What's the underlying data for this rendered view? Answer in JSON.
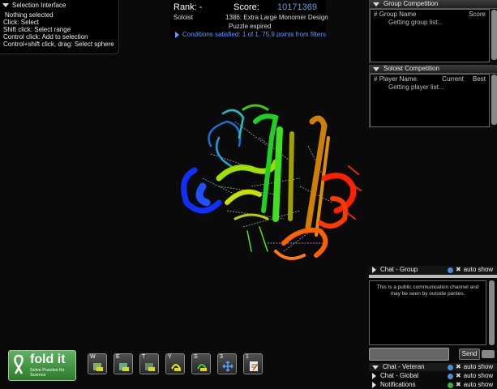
{
  "selection": {
    "title": "Selection Interface",
    "lines": [
      "Nothing selected",
      "Click: Select",
      "Shift click: Select range",
      "Control click: Add to selection",
      "Control+shift click, drag: Select sphere"
    ]
  },
  "score": {
    "rank_label": "Rank: -",
    "score_label": "Score:",
    "score_value": "10171369",
    "mode": "Soloist",
    "puzzle": "1386: Extra Large Monomer Design",
    "status": "Puzzle expired",
    "conditions": "Conditions satisfied: 1 of 1, 75.9 points from filters"
  },
  "group": {
    "title": "Group Competition",
    "col_num": "#",
    "col_name": "Group Name",
    "col_score": "Score",
    "loading": "Getting group list..."
  },
  "soloist": {
    "title": "Soloist Competition",
    "col_num": "#",
    "col_name": "Player Name",
    "col_current": "Current",
    "col_best": "Best",
    "loading": "Getting player list..."
  },
  "chat": {
    "group_title": "Chat - Group",
    "auto_show": "auto show",
    "message": "This is a public communication channel and may be seen by outside parties.",
    "send": "Send",
    "veteran": "Chat - Veteran",
    "global": "Chat - Global",
    "notifications": "Notifications"
  },
  "logo": {
    "name": "fold it",
    "tagline": "Solve Puzzles for Science"
  },
  "toolbar": [
    {
      "key": "W",
      "icon": "wiggle-all-icon"
    },
    {
      "key": "E",
      "icon": "wiggle-sidechains-all-icon"
    },
    {
      "key": "T",
      "icon": "tweak-all-icon"
    },
    {
      "key": "Y",
      "icon": "shake-all-icon"
    },
    {
      "key": "S",
      "icon": "shake-sidechains-icon"
    },
    {
      "key": "3",
      "icon": "move-icon"
    },
    {
      "key": "1",
      "icon": "notes-icon"
    }
  ],
  "colors": {
    "accent": "#5aa0ff",
    "info": "#4a8fd6",
    "green": "#3cb43c"
  }
}
